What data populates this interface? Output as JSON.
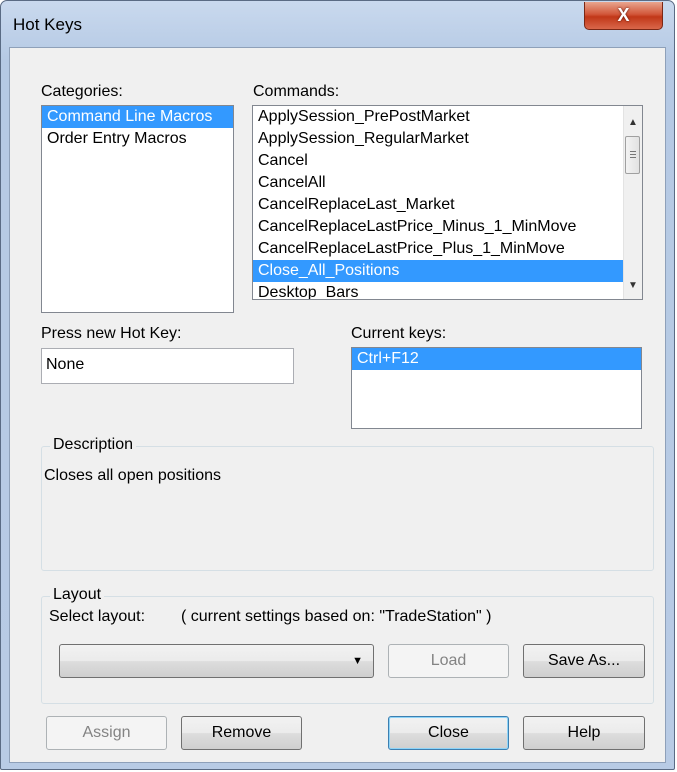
{
  "window": {
    "title": "Hot Keys",
    "close_glyph": "X"
  },
  "categories": {
    "label": "Categories:",
    "items": [
      "Command Line Macros",
      "Order Entry Macros"
    ],
    "selected_index": 0
  },
  "commands": {
    "label": "Commands:",
    "items": [
      "ApplySession_PrePostMarket",
      "ApplySession_RegularMarket",
      "Cancel",
      "CancelAll",
      "CancelReplaceLast_Market",
      "CancelReplaceLastPrice_Minus_1_MinMove",
      "CancelReplaceLastPrice_Plus_1_MinMove",
      "Close_All_Positions",
      "Desktop_Bars"
    ],
    "selected_index": 7
  },
  "press_new_hotkey": {
    "label": "Press new Hot Key:",
    "value": "None"
  },
  "current_keys": {
    "label": "Current keys:",
    "items": [
      "Ctrl+F12"
    ],
    "selected_index": 0
  },
  "description": {
    "title": "Description",
    "text": "Closes all open positions"
  },
  "layout": {
    "title": "Layout",
    "select_label": "Select layout:",
    "settings_note": "( current settings based on: \"TradeStation\" )",
    "selected_value": "",
    "load_label": "Load",
    "save_as_label": "Save As..."
  },
  "buttons": {
    "assign": "Assign",
    "remove": "Remove",
    "close": "Close",
    "help": "Help"
  },
  "colors": {
    "selection": "#3399ff",
    "titlebar": "#b8cbe5",
    "close_button": "#c13718"
  }
}
